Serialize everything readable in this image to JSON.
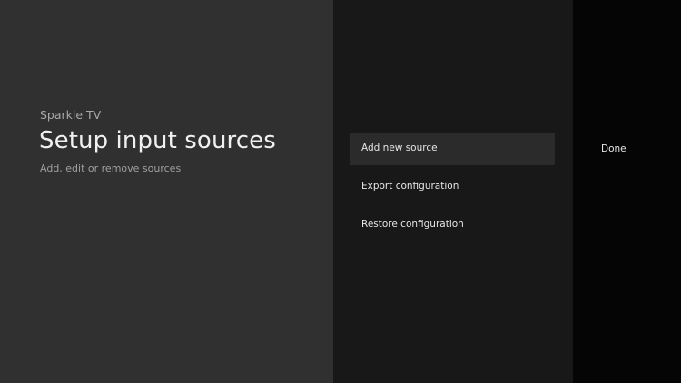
{
  "guidance": {
    "breadcrumb": "Sparkle TV",
    "title": "Setup input sources",
    "description": "Add, edit or remove sources"
  },
  "actions": [
    {
      "label": "Add new source",
      "focused": true
    },
    {
      "label": "Export configuration",
      "focused": false
    },
    {
      "label": "Restore configuration",
      "focused": false
    }
  ],
  "side_actions": [
    {
      "label": "Done"
    }
  ]
}
